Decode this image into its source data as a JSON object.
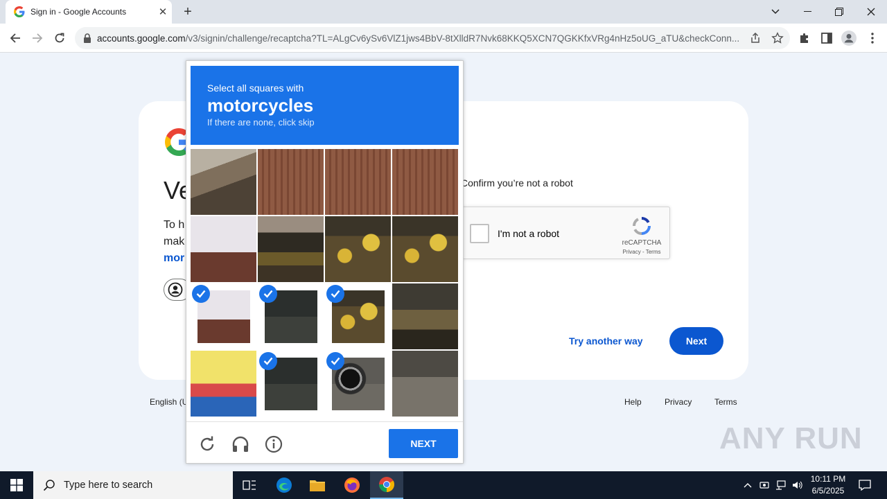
{
  "browser": {
    "tab_title": "Sign in - Google Accounts",
    "url_host": "accounts.google.com",
    "url_path": "/v3/signin/challenge/recaptcha?TL=ALgCv6ySv6VlZ1jws4BbV-8tXlldR7Nvk68KKQ5XCN7QGKKfxVRg4nHz5oUG_aTU&checkConn..."
  },
  "signin": {
    "heading": "Ve",
    "desc_line1": "To h",
    "desc_line2": "mak",
    "more_link": "mor",
    "confirm_text": "Confirm you’re not a robot",
    "recaptcha_label": "I'm not a robot",
    "recaptcha_brand": "reCAPTCHA",
    "recaptcha_terms": "Privacy - Terms",
    "try_another": "Try another way",
    "next": "Next",
    "footer_lang": "English (U",
    "footer_help": "Help",
    "footer_privacy": "Privacy",
    "footer_terms": "Terms"
  },
  "challenge": {
    "instruction": "Select all squares with",
    "target": "motorcycles",
    "hint": "If there are none, click skip",
    "next_button": "NEXT",
    "tiles": [
      {
        "scene": "roof-left",
        "selected": false
      },
      {
        "scene": "roof",
        "selected": false
      },
      {
        "scene": "roof",
        "selected": false
      },
      {
        "scene": "roof",
        "selected": false
      },
      {
        "scene": "shop-sign",
        "selected": false
      },
      {
        "scene": "market",
        "selected": false
      },
      {
        "scene": "fruit",
        "selected": false
      },
      {
        "scene": "fruit",
        "selected": false
      },
      {
        "scene": "shop-sign",
        "selected": true
      },
      {
        "scene": "dark",
        "selected": true
      },
      {
        "scene": "fruit",
        "selected": true
      },
      {
        "scene": "stall",
        "selected": false
      },
      {
        "scene": "sign",
        "selected": false
      },
      {
        "scene": "dark",
        "selected": true
      },
      {
        "scene": "wheel",
        "selected": true
      },
      {
        "scene": "road",
        "selected": false
      }
    ]
  },
  "taskbar": {
    "search_placeholder": "Type here to search",
    "time": "10:11 PM",
    "date": "6/5/2025"
  },
  "watermark": "ANY RUN",
  "colors": {
    "google_blue": "#0b57d0",
    "recaptcha_blue": "#1a73e8",
    "taskbar": "#101a2a"
  }
}
